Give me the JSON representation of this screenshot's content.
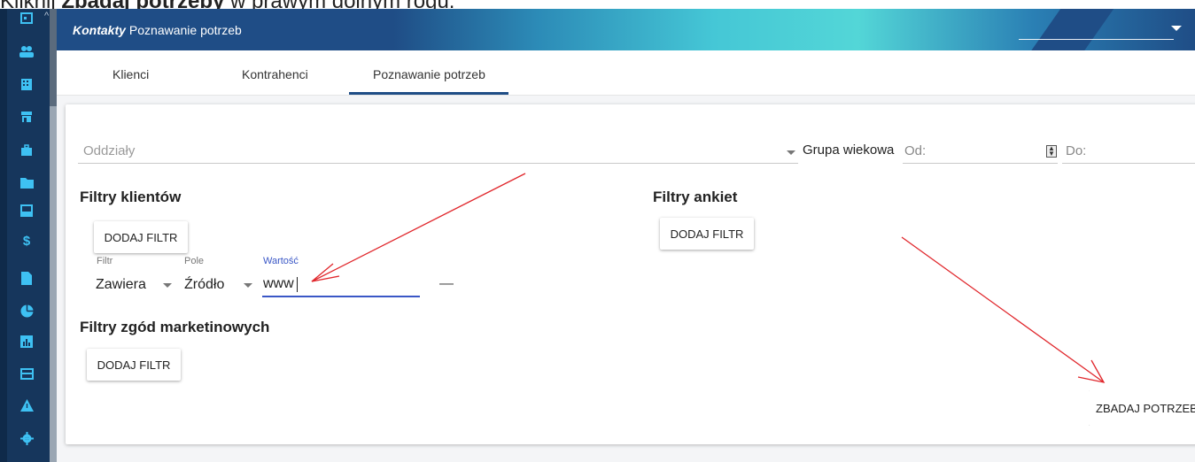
{
  "instruction": {
    "prefix": "Kliknij ",
    "bold": "Zbadaj potrzeby",
    "suffix": " w prawym dolnym rogu."
  },
  "header": {
    "module": "Kontakty",
    "title": "Poznawanie potrzeb"
  },
  "tabs": [
    {
      "label": "Klienci"
    },
    {
      "label": "Kontrahenci"
    },
    {
      "label": "Poznawanie potrzeb",
      "active": true
    }
  ],
  "filters_top": {
    "branches_placeholder": "Oddziały",
    "age_group_label": "Grupa wiekowa",
    "from_placeholder": "Od:",
    "to_placeholder": "Do:"
  },
  "client_filters": {
    "title": "Filtry klientów",
    "add_button": "DODAJ FILTR",
    "row": {
      "filter_label": "Filtr",
      "filter_value": "Zawiera",
      "field_label": "Pole",
      "field_value": "Źródło",
      "value_label": "Wartość",
      "value": "www",
      "remove": "—"
    }
  },
  "survey_filters": {
    "title": "Filtry ankiet",
    "add_button": "DODAJ FILTR"
  },
  "marketing_filters": {
    "title": "Filtry zgód marketinowych",
    "add_button": "DODAJ FILTR"
  },
  "submit_button": "ZBADAJ POTRZEBY",
  "colors": {
    "sidebar": "#16365c",
    "header": "#1f4d86",
    "accent": "#3ec1f3",
    "arrow": "#e0262b",
    "active_input": "#3a57c6"
  },
  "sidebar_icons": [
    "calendar-icon",
    "people-icon",
    "building-icon",
    "store-icon",
    "briefcase-icon",
    "folder-icon",
    "inbox-icon",
    "dollar-icon",
    "file-icon",
    "pie-chart-icon",
    "bar-chart-icon",
    "card-icon",
    "warning-icon",
    "settings-icon"
  ]
}
